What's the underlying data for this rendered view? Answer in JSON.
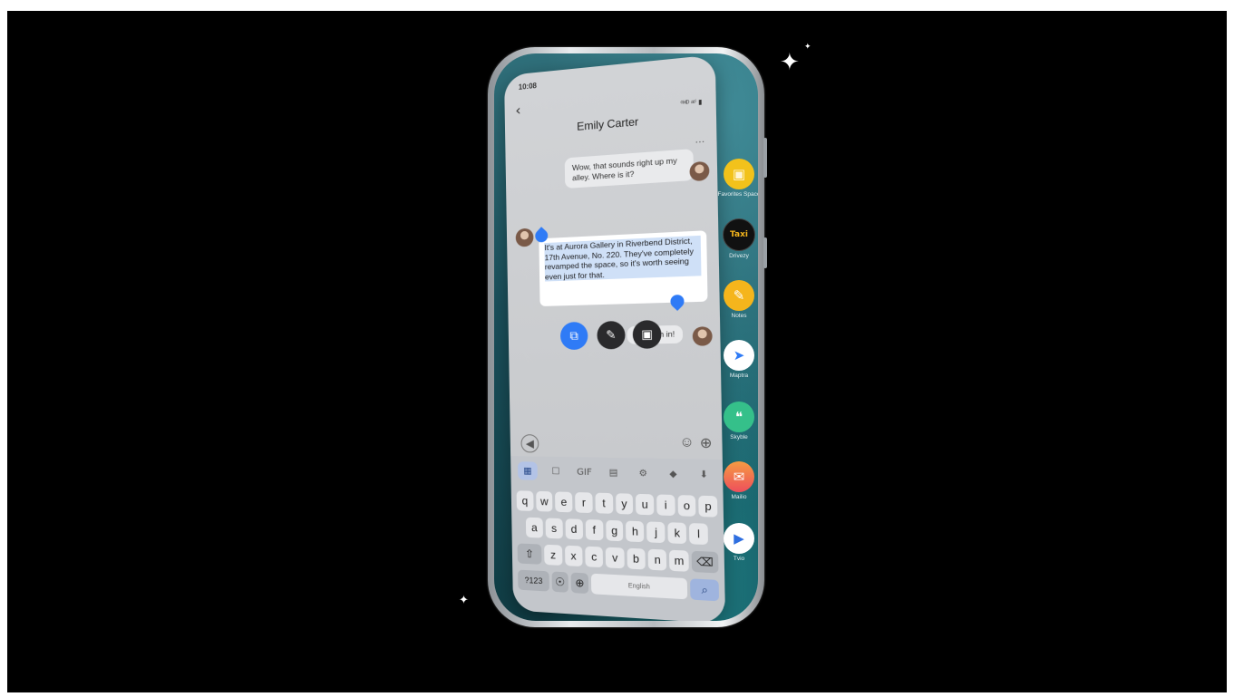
{
  "status": {
    "time": "10:08",
    "icons": "⁰ᴴᴰ ᵃᵗⁱ ▮"
  },
  "chat": {
    "contact_name": "Emily Carter",
    "back_glyph": "‹",
    "more_glyph": "···",
    "message_sent_1": "Wow, that sounds right up my alley. Where is it?",
    "message_received_selected": "It's at Aurora Gallery in Riverbend District, 17th Avenue, No. 220. They've completely revamped the space, so it's worth seeing even just for that.",
    "message_sent_2": "I'm in!",
    "message_sent_2_partial": "an"
  },
  "selection_actions": [
    {
      "name": "ai-translate",
      "glyph": "⧉",
      "color": "#2f7bf6"
    },
    {
      "name": "edit",
      "glyph": "✎",
      "color": "#2a2a2c"
    },
    {
      "name": "save",
      "glyph": "▣",
      "color": "#2a2a2c"
    }
  ],
  "composer": {
    "voice_glyph": "◀",
    "emoji_glyph": "☺",
    "add_glyph": "⊕"
  },
  "keyboard": {
    "toolbar": [
      "▦",
      "☐",
      "GIF",
      "▤",
      "⚙",
      "◆",
      "⬇"
    ],
    "row1": [
      "q",
      "w",
      "e",
      "r",
      "t",
      "y",
      "u",
      "i",
      "o",
      "p"
    ],
    "row2": [
      "a",
      "s",
      "d",
      "f",
      "g",
      "h",
      "j",
      "k",
      "l"
    ],
    "row3": [
      "⇧",
      "z",
      "x",
      "c",
      "v",
      "b",
      "n",
      "m",
      "⌫"
    ],
    "row4": {
      "numbers": "?123",
      "mic": "☉",
      "globe": "⊕",
      "space": "English",
      "search": "⌕"
    }
  },
  "dock": [
    {
      "label": "Favorites Space",
      "glyph": "▣",
      "color": "#f2c21b"
    },
    {
      "label": "Drivezy",
      "glyph": "Taxi",
      "color": "#111111"
    },
    {
      "label": "Notes",
      "glyph": "✎",
      "color": "#f5b51c"
    },
    {
      "label": "Maptra",
      "glyph": "➤",
      "color": "#ffffff"
    },
    {
      "label": "Skyble",
      "glyph": "❝",
      "color": "#35c08a"
    },
    {
      "label": "Mailio",
      "glyph": "✉",
      "color": "#f06246"
    },
    {
      "label": "Tvio",
      "glyph": "▶",
      "color": "#ffffff"
    }
  ],
  "sparkles": [
    "✦",
    "✦",
    "✦"
  ]
}
